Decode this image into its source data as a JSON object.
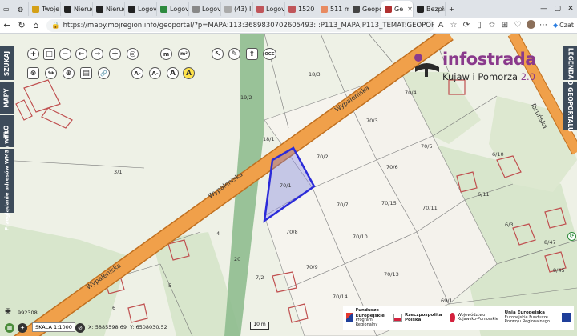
{
  "browser": {
    "tabs": [
      {
        "label": "Twoje",
        "color": "#d4a017"
      },
      {
        "label": "Nieruc",
        "color": "#222222"
      },
      {
        "label": "Nieruc",
        "color": "#222222"
      },
      {
        "label": "Logov",
        "color": "#222222"
      },
      {
        "label": "Logov",
        "color": "#2d8a3e"
      },
      {
        "label": "Logov",
        "color": "#888888"
      },
      {
        "label": "(43) In",
        "color": "#aaaaaa"
      },
      {
        "label": "Logov",
        "color": "#c0555a"
      },
      {
        "label": "1520",
        "color": "#c0555a"
      },
      {
        "label": "511 m",
        "color": "#e88a60"
      },
      {
        "label": "Geopo",
        "color": "#444444"
      },
      {
        "label": "Ge",
        "color": "#b03030",
        "active": true
      },
      {
        "label": "Bezpła",
        "color": "#222222"
      }
    ],
    "new_tab": "+",
    "url": "https://mapy.mojregion.info/geoportal/?p=MAPA:113:3689830702605493:::P113_MAPA,P113_TEMAT:GEOPORTAL_EGIB,D#",
    "chat_label": "Czat"
  },
  "side_left": [
    "SZUKAJ",
    "MAPY",
    "TŁO",
    "Przeglądanie adresów WMS / WFS"
  ],
  "side_right": [
    "LEGENDA",
    "O GEOPORTALU"
  ],
  "toolbar": {
    "row1": [
      "+",
      "□",
      "−",
      "←",
      "→",
      "✛",
      "◎",
      "m",
      "m²",
      "↖",
      "✎",
      "⇪",
      "OGC"
    ],
    "row2": [
      "⊗",
      "↪",
      "⊕",
      "▤",
      "🔗",
      "A-",
      "A-",
      "A",
      "A"
    ]
  },
  "logo": {
    "title": "infostrada",
    "subtitle": "Kujaw i Pomorza",
    "version": "2.0"
  },
  "map": {
    "road_name": "Wypaleniska",
    "road_name_2": "Toruńska",
    "parcels": [
      "18/3",
      "70/4",
      "19/2",
      "70/3",
      "18/1",
      "70/2",
      "70/6",
      "70/5",
      "6/10",
      "3/1",
      "70/1",
      "70/7",
      "70/15",
      "70/11",
      "6/11",
      "70/8",
      "70/10",
      "6/3",
      "4",
      "8/47",
      "70/9",
      "70/13",
      "7/2",
      "20",
      "8/45",
      "5",
      "70/14",
      "6",
      "69/1"
    ],
    "selected_parcel": "70/1"
  },
  "status": {
    "scale": "SKALA 1:1000",
    "x": "X: 5885598.69",
    "y": "Y: 6508030.52",
    "coords_top": "992308",
    "scalebar": "10 m"
  },
  "eu": {
    "fe_title": "Fundusze Europejskie",
    "fe_sub": "Program Regionalny",
    "pl": "Rzeczpospolita Polska",
    "kp_title": "Województwo Kujawsko-Pomorskie",
    "ue_title": "Unia Europejska",
    "ue_sub": "Europejskie Fundusze Rozwoju Regionalnego"
  },
  "colors": {
    "road": "#f0a04a",
    "road_edge": "#c07020",
    "selection": "#2b2bd9",
    "green": "#8fbc8f",
    "plot": "#f6f4ee",
    "building": "#c05050"
  }
}
